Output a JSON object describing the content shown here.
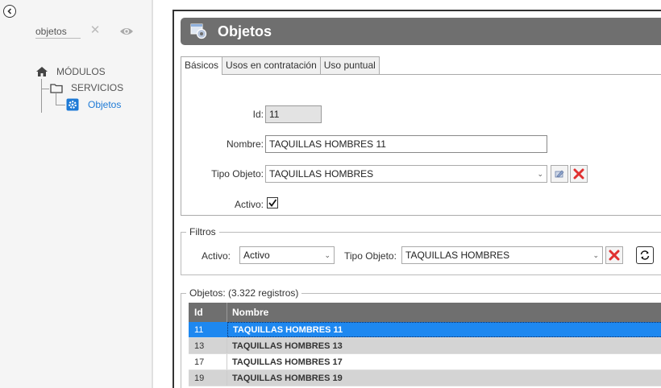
{
  "sidebar": {
    "search": {
      "value": "objetos",
      "placeholder": ""
    },
    "tree": {
      "root": "MÓDULOS",
      "child": "SERVICIOS",
      "leaf": "Objetos"
    }
  },
  "window": {
    "title": "Objetos",
    "tabs": [
      {
        "label": "Básicos",
        "active": true
      },
      {
        "label": "Usos en contratación",
        "active": false
      },
      {
        "label": "Uso puntual",
        "active": false
      }
    ],
    "form": {
      "id_label": "Id:",
      "id_value": "11",
      "nombre_label": "Nombre:",
      "nombre_value": "TAQUILLAS HOMBRES 11",
      "tipo_label": "Tipo Objeto:",
      "tipo_value": "TAQUILLAS HOMBRES",
      "activo_label": "Activo:",
      "activo_checked": true
    },
    "filters": {
      "legend": "Filtros",
      "activo_label": "Activo:",
      "activo_value": "Activo",
      "tipo_label": "Tipo Objeto:",
      "tipo_value": "TAQUILLAS HOMBRES"
    },
    "list": {
      "legend": "Objetos:",
      "count": "(3.322 registros)",
      "columns": [
        "Id",
        "Nombre"
      ],
      "rows": [
        {
          "id": "11",
          "nombre": "TAQUILLAS HOMBRES 11",
          "selected": true
        },
        {
          "id": "13",
          "nombre": "TAQUILLAS HOMBRES 13",
          "selected": false
        },
        {
          "id": "17",
          "nombre": "TAQUILLAS HOMBRES 17",
          "selected": false
        },
        {
          "id": "19",
          "nombre": "TAQUILLAS HOMBRES 19",
          "selected": false
        }
      ]
    }
  },
  "colors": {
    "accent": "#1e88f0",
    "header_gray": "#6f6f6f",
    "link_blue": "#1e7ad6",
    "delete_red": "#e03030"
  },
  "icons": {
    "back": "chevron-left-icon",
    "clear": "close-icon",
    "visibility": "eye-icon",
    "home": "home-icon",
    "folder": "folder-icon",
    "settings": "gear-icon",
    "window": "gear-window-icon",
    "edit": "edit-icon",
    "delete": "delete-icon",
    "refresh": "refresh-icon"
  }
}
